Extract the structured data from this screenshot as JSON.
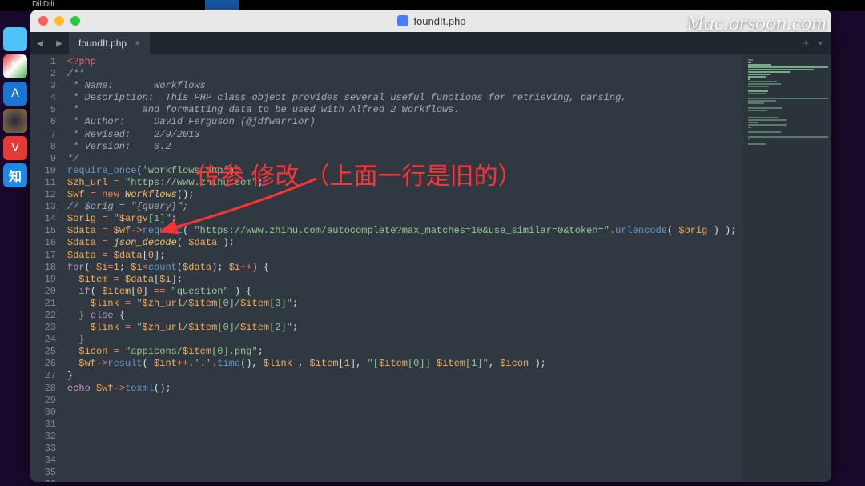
{
  "topstrip_label": "DiliDili",
  "watermark": "Mac.orsoon.com",
  "window": {
    "title": "foundIt.php"
  },
  "tab": {
    "label": "foundIt.php"
  },
  "annotation_text": "传参 修改 （上面一行是旧的）",
  "dock": {
    "zhihu": "知"
  },
  "lines": [
    {
      "n": 1,
      "seg": [
        {
          "c": "c-tag",
          "t": "<?php"
        }
      ]
    },
    {
      "n": 2,
      "seg": [
        {
          "c": "c-cm",
          "t": "/**"
        }
      ]
    },
    {
      "n": 3,
      "seg": [
        {
          "c": "c-cm",
          "t": " * Name:       Workflows"
        }
      ]
    },
    {
      "n": 4,
      "seg": [
        {
          "c": "c-cm",
          "t": " * Description:  This PHP class object provides several useful functions for retrieving, parsing,"
        }
      ]
    },
    {
      "n": 5,
      "seg": [
        {
          "c": "c-cm",
          "t": " *           and formatting data to be used with Alfred 2 Workflows."
        }
      ]
    },
    {
      "n": 6,
      "seg": [
        {
          "c": "c-cm",
          "t": " * Author:     David Ferguson (@jdfwarrior)"
        }
      ]
    },
    {
      "n": 7,
      "seg": [
        {
          "c": "c-cm",
          "t": " * Revised:    2/9/2013"
        }
      ]
    },
    {
      "n": 8,
      "seg": [
        {
          "c": "c-cm",
          "t": " * Version:    0.2"
        }
      ]
    },
    {
      "n": 9,
      "seg": [
        {
          "c": "c-cm",
          "t": "*/"
        }
      ]
    },
    {
      "n": 10,
      "seg": [
        {
          "c": "c-fn",
          "t": "require_once"
        },
        {
          "t": "("
        },
        {
          "c": "c-str",
          "t": "'workflows.php'"
        },
        {
          "t": ");"
        }
      ]
    },
    {
      "n": 11,
      "seg": [
        {
          "c": "c-var",
          "t": "$zh_url"
        },
        {
          "t": " "
        },
        {
          "c": "c-op",
          "t": "="
        },
        {
          "t": " "
        },
        {
          "c": "c-str",
          "t": "\"https://www.zhihu.com\""
        },
        {
          "t": ";"
        }
      ]
    },
    {
      "n": 12,
      "seg": [
        {
          "c": "c-var",
          "t": "$wf"
        },
        {
          "t": " "
        },
        {
          "c": "c-op",
          "t": "="
        },
        {
          "t": " "
        },
        {
          "c": "c-op",
          "t": "new"
        },
        {
          "t": " "
        },
        {
          "c": "c-cls",
          "t": "Workflows"
        },
        {
          "t": "();"
        }
      ]
    },
    {
      "n": 13,
      "seg": [
        {
          "t": ""
        }
      ]
    },
    {
      "n": 14,
      "seg": [
        {
          "c": "c-cm",
          "t": "// $orig = \"{query}\";"
        }
      ]
    },
    {
      "n": 15,
      "seg": [
        {
          "c": "c-var",
          "t": "$orig"
        },
        {
          "t": " "
        },
        {
          "c": "c-op",
          "t": "="
        },
        {
          "t": " "
        },
        {
          "c": "c-str",
          "t": "\""
        },
        {
          "c": "c-var",
          "t": "$argv"
        },
        {
          "c": "c-str",
          "t": "[1]\""
        },
        {
          "t": ";"
        }
      ]
    },
    {
      "n": 16,
      "seg": [
        {
          "t": ""
        }
      ]
    },
    {
      "n": 17,
      "seg": [
        {
          "c": "c-var",
          "t": "$data"
        },
        {
          "t": " "
        },
        {
          "c": "c-op",
          "t": "="
        },
        {
          "t": " "
        },
        {
          "c": "c-var",
          "t": "$wf"
        },
        {
          "c": "c-op",
          "t": "->"
        },
        {
          "c": "c-fn",
          "t": "request"
        },
        {
          "t": "( "
        },
        {
          "c": "c-str",
          "t": "\"https://www.zhihu.com/autocomplete?max_matches=10&use_similar=0&token=\""
        },
        {
          "c": "c-op",
          "t": "."
        },
        {
          "c": "c-fn",
          "t": "urlencode"
        },
        {
          "t": "( "
        },
        {
          "c": "c-var",
          "t": "$orig"
        },
        {
          "t": " ) );"
        }
      ]
    },
    {
      "n": 18,
      "seg": [
        {
          "c": "c-var",
          "t": "$data"
        },
        {
          "t": " "
        },
        {
          "c": "c-op",
          "t": "="
        },
        {
          "t": " "
        },
        {
          "c": "c-cls",
          "t": "json_decode"
        },
        {
          "t": "( "
        },
        {
          "c": "c-var",
          "t": "$data"
        },
        {
          "t": " );"
        }
      ]
    },
    {
      "n": 19,
      "seg": [
        {
          "c": "c-var",
          "t": "$data"
        },
        {
          "t": " "
        },
        {
          "c": "c-op",
          "t": "="
        },
        {
          "t": " "
        },
        {
          "c": "c-var",
          "t": "$data"
        },
        {
          "t": "["
        },
        {
          "c": "c-num",
          "t": "0"
        },
        {
          "t": "];"
        }
      ]
    },
    {
      "n": 20,
      "seg": [
        {
          "t": ""
        }
      ]
    },
    {
      "n": 21,
      "seg": [
        {
          "c": "c-kw",
          "t": "for"
        },
        {
          "t": "( "
        },
        {
          "c": "c-var",
          "t": "$i"
        },
        {
          "c": "c-op",
          "t": "="
        },
        {
          "c": "c-num",
          "t": "1"
        },
        {
          "t": "; "
        },
        {
          "c": "c-var",
          "t": "$i"
        },
        {
          "c": "c-op",
          "t": "<"
        },
        {
          "c": "c-fn",
          "t": "count"
        },
        {
          "t": "("
        },
        {
          "c": "c-var",
          "t": "$data"
        },
        {
          "t": "); "
        },
        {
          "c": "c-var",
          "t": "$i"
        },
        {
          "c": "c-op",
          "t": "++"
        },
        {
          "t": ") {"
        }
      ]
    },
    {
      "n": 22,
      "seg": [
        {
          "t": "  "
        },
        {
          "c": "c-var",
          "t": "$item"
        },
        {
          "t": " "
        },
        {
          "c": "c-op",
          "t": "="
        },
        {
          "t": " "
        },
        {
          "c": "c-var",
          "t": "$data"
        },
        {
          "t": "["
        },
        {
          "c": "c-var",
          "t": "$i"
        },
        {
          "t": "];"
        }
      ]
    },
    {
      "n": 23,
      "seg": [
        {
          "t": ""
        }
      ]
    },
    {
      "n": 24,
      "seg": [
        {
          "t": ""
        }
      ]
    },
    {
      "n": 25,
      "seg": [
        {
          "t": "  "
        },
        {
          "c": "c-kw",
          "t": "if"
        },
        {
          "t": "( "
        },
        {
          "c": "c-var",
          "t": "$item"
        },
        {
          "t": "["
        },
        {
          "c": "c-num",
          "t": "0"
        },
        {
          "t": "] "
        },
        {
          "c": "c-op",
          "t": "=="
        },
        {
          "t": " "
        },
        {
          "c": "c-str",
          "t": "\"question\""
        },
        {
          "t": " ) {"
        }
      ]
    },
    {
      "n": 26,
      "seg": [
        {
          "t": "    "
        },
        {
          "c": "c-var",
          "t": "$link"
        },
        {
          "t": " "
        },
        {
          "c": "c-op",
          "t": "="
        },
        {
          "t": " "
        },
        {
          "c": "c-str",
          "t": "\""
        },
        {
          "c": "c-var",
          "t": "$zh_url"
        },
        {
          "c": "c-str",
          "t": "/"
        },
        {
          "c": "c-var",
          "t": "$item"
        },
        {
          "c": "c-str",
          "t": "[0]/"
        },
        {
          "c": "c-var",
          "t": "$item"
        },
        {
          "c": "c-str",
          "t": "[3]\""
        },
        {
          "t": ";"
        }
      ]
    },
    {
      "n": 27,
      "seg": [
        {
          "t": "  } "
        },
        {
          "c": "c-kw",
          "t": "else"
        },
        {
          "t": " {"
        }
      ]
    },
    {
      "n": 28,
      "seg": [
        {
          "t": "    "
        },
        {
          "c": "c-var",
          "t": "$link"
        },
        {
          "t": " "
        },
        {
          "c": "c-op",
          "t": "="
        },
        {
          "t": " "
        },
        {
          "c": "c-str",
          "t": "\""
        },
        {
          "c": "c-var",
          "t": "$zh_url"
        },
        {
          "c": "c-str",
          "t": "/"
        },
        {
          "c": "c-var",
          "t": "$item"
        },
        {
          "c": "c-str",
          "t": "[0]/"
        },
        {
          "c": "c-var",
          "t": "$item"
        },
        {
          "c": "c-str",
          "t": "[2]\""
        },
        {
          "t": ";"
        }
      ]
    },
    {
      "n": 29,
      "seg": [
        {
          "t": "  }"
        }
      ]
    },
    {
      "n": 30,
      "seg": [
        {
          "t": ""
        }
      ]
    },
    {
      "n": 31,
      "seg": [
        {
          "t": "  "
        },
        {
          "c": "c-var",
          "t": "$icon"
        },
        {
          "t": " "
        },
        {
          "c": "c-op",
          "t": "="
        },
        {
          "t": " "
        },
        {
          "c": "c-str",
          "t": "\"appicons/"
        },
        {
          "c": "c-var",
          "t": "$item"
        },
        {
          "c": "c-str",
          "t": "[0].png\""
        },
        {
          "t": ";"
        }
      ]
    },
    {
      "n": 32,
      "seg": [
        {
          "t": ""
        }
      ]
    },
    {
      "n": 33,
      "seg": [
        {
          "t": "  "
        },
        {
          "c": "c-var",
          "t": "$wf"
        },
        {
          "c": "c-op",
          "t": "->"
        },
        {
          "c": "c-fn",
          "t": "result"
        },
        {
          "t": "( "
        },
        {
          "c": "c-var",
          "t": "$int"
        },
        {
          "c": "c-op",
          "t": "++."
        },
        {
          "c": "c-str",
          "t": "'.'"
        },
        {
          "c": "c-op",
          "t": "."
        },
        {
          "c": "c-fn",
          "t": "time"
        },
        {
          "t": "(), "
        },
        {
          "c": "c-var",
          "t": "$link"
        },
        {
          "t": " , "
        },
        {
          "c": "c-var",
          "t": "$item"
        },
        {
          "t": "["
        },
        {
          "c": "c-num",
          "t": "1"
        },
        {
          "t": "], "
        },
        {
          "c": "c-str",
          "t": "\"["
        },
        {
          "c": "c-var",
          "t": "$item"
        },
        {
          "c": "c-str",
          "t": "[0]] "
        },
        {
          "c": "c-var",
          "t": "$item"
        },
        {
          "c": "c-str",
          "t": "[1]\""
        },
        {
          "t": ", "
        },
        {
          "c": "c-var",
          "t": "$icon"
        },
        {
          "t": " );"
        }
      ]
    },
    {
      "n": 34,
      "seg": [
        {
          "t": "}"
        }
      ]
    },
    {
      "n": 35,
      "seg": [
        {
          "t": ""
        }
      ]
    },
    {
      "n": 36,
      "partial": true,
      "seg": [
        {
          "c": "c-echo",
          "t": "echo"
        },
        {
          "t": " "
        },
        {
          "c": "c-var",
          "t": "$wf"
        },
        {
          "c": "c-op",
          "t": "->"
        },
        {
          "c": "c-fn",
          "t": "toxml"
        },
        {
          "t": "();"
        }
      ]
    }
  ]
}
